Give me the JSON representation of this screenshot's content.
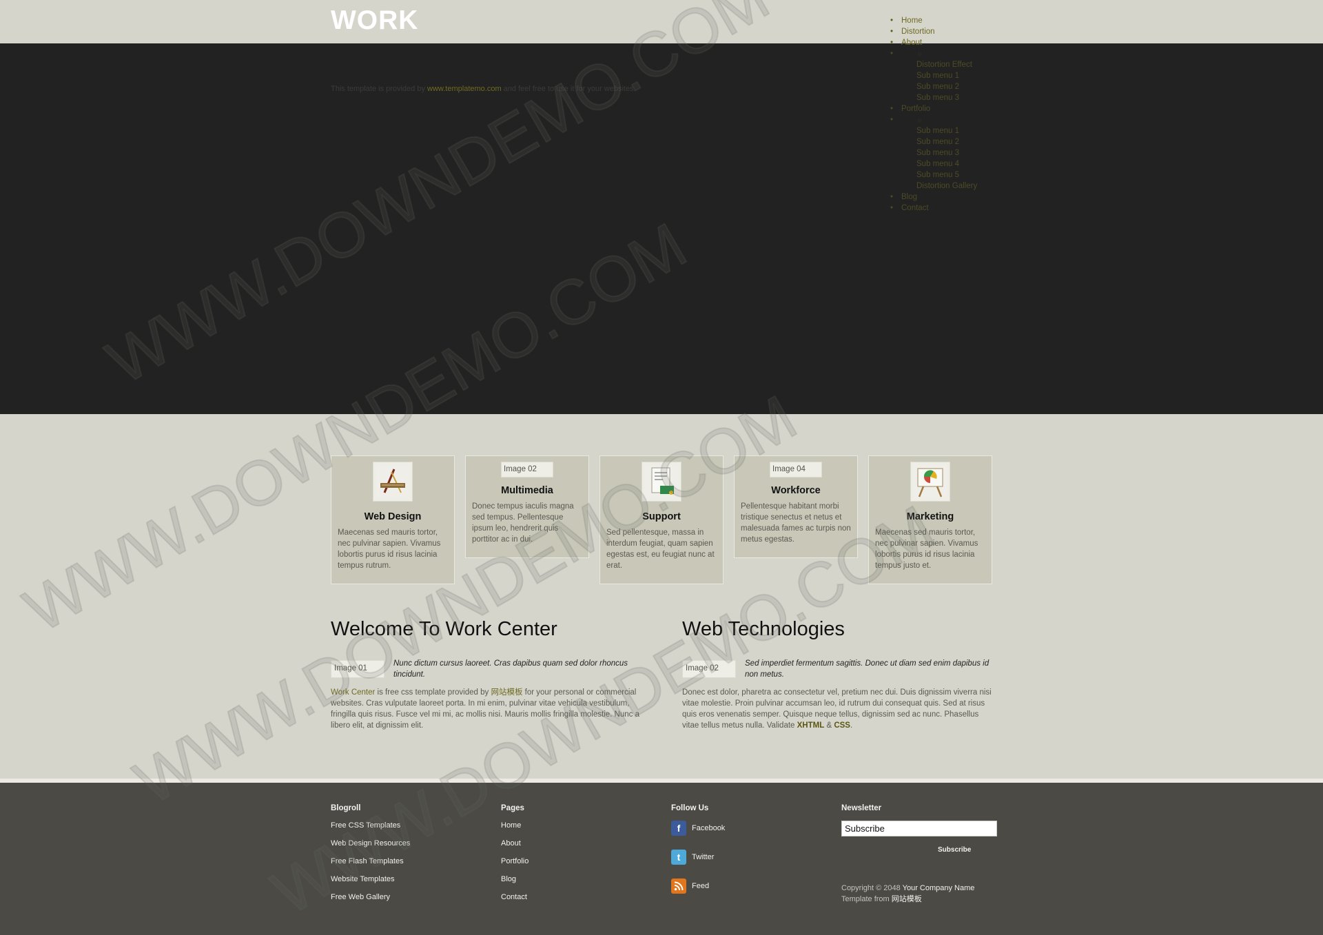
{
  "header": {
    "title": "WORK",
    "note_before": "This template is provided by",
    "note_link": "www.templatemo.com",
    "note_after": "and feel free to use it for your websites."
  },
  "menu": {
    "home": "Home",
    "distortion": "Distortion",
    "about": "About",
    "about_sub": [
      "Distortion Effect",
      "Sub menu 1",
      "Sub menu 2",
      "Sub menu 3"
    ],
    "portfolio": "Portfolio",
    "portfolio_sub": [
      "Sub menu 1",
      "Sub menu 2",
      "Sub menu 3",
      "Sub menu 4",
      "Sub menu 5",
      "Distortion Gallery"
    ],
    "blog": "Blog",
    "contact": "Contact"
  },
  "services": [
    {
      "title": "Web Design",
      "text": "Maecenas sed mauris tortor, nec pulvinar sapien. Vivamus lobortis purus id risus lacinia tempus rutrum."
    },
    {
      "title": "Multimedia",
      "img_alt": "Image 02",
      "text": "Donec tempus iaculis magna sed tempus. Pellentesque ipsum leo, hendrerit quis porttitor ac in dui."
    },
    {
      "title": "Support",
      "text": "Sed pellentesque, massa in interdum feugiat, quam sapien egestas est, eu feugiat nunc at erat."
    },
    {
      "title": "Workforce",
      "img_alt": "Image 04",
      "text": "Pellentesque habitant morbi tristique senectus et netus et malesuada fames ac turpis non metus egestas."
    },
    {
      "title": "Marketing",
      "text": "Maecenas sed mauris tortor, nec pulvinar sapien. Vivamus lobortis purus id risus lacinia tempus justo et."
    }
  ],
  "welcome": {
    "title": "Welcome To Work Center",
    "img_alt": "Image 01",
    "quote": "Nunc dictum cursus laoreet. Cras dapibus quam sed dolor rhoncus tincidunt.",
    "link1": "Work Center",
    "text1": " is free css template provided by ",
    "link2": "网站模板",
    "text2": " for your personal or commercial websites. Cras vulputate laoreet porta. In mi enim, pulvinar vitae vehicula vestibulum, fringilla quis risus. Fusce vel mi mi, ac mollis nisi. Mauris mollis fringilla molestie. Nunc a libero elit, at dignissim elit."
  },
  "tech": {
    "title": "Web Technologies",
    "img_alt": "Image 02",
    "quote": "Sed imperdiet fermentum sagittis. Donec ut diam sed enim dapibus id non metus.",
    "text": "Donec est dolor, pharetra ac consectetur vel, pretium nec dui. Duis dignissim viverra nisi vitae molestie. Proin pulvinar accumsan leo, id rutrum dui consequat quis. Sed at risus quis eros venenatis semper. Quisque neque tellus, dignissim sed ac nunc. Phasellus vitae tellus metus nulla. Validate ",
    "xhtml": "XHTML",
    "amp": " & ",
    "css": "CSS",
    "dot": "."
  },
  "footer": {
    "blogroll": {
      "title": "Blogroll",
      "links": [
        "Free CSS Templates",
        "Web Design Resources",
        "Free Flash Templates",
        "Website Templates",
        "Free Web Gallery"
      ]
    },
    "pages": {
      "title": "Pages",
      "links": [
        "Home",
        "About",
        "Portfolio",
        "Blog",
        "Contact"
      ]
    },
    "follow": {
      "title": "Follow Us",
      "items": [
        {
          "label": "Facebook",
          "icon": "facebook-icon"
        },
        {
          "label": "Twitter",
          "icon": "twitter-icon"
        },
        {
          "label": "Feed",
          "icon": "rss-icon"
        }
      ]
    },
    "newsletter": {
      "title": "Newsletter",
      "input_value": "Subscribe",
      "button": "Subscribe"
    },
    "copyright_prefix": "Copyright © 2048",
    "company": "Your Company Name",
    "template_prefix": "Template from",
    "template_link": "网站模板"
  },
  "watermark": "WWW.DOWNDEMO.COM",
  "colors": {
    "background": "#d6d5cc",
    "banner": "#222222",
    "footer": "#4b4a45",
    "link": "#6e6a22",
    "box": "#c8c7b8"
  }
}
